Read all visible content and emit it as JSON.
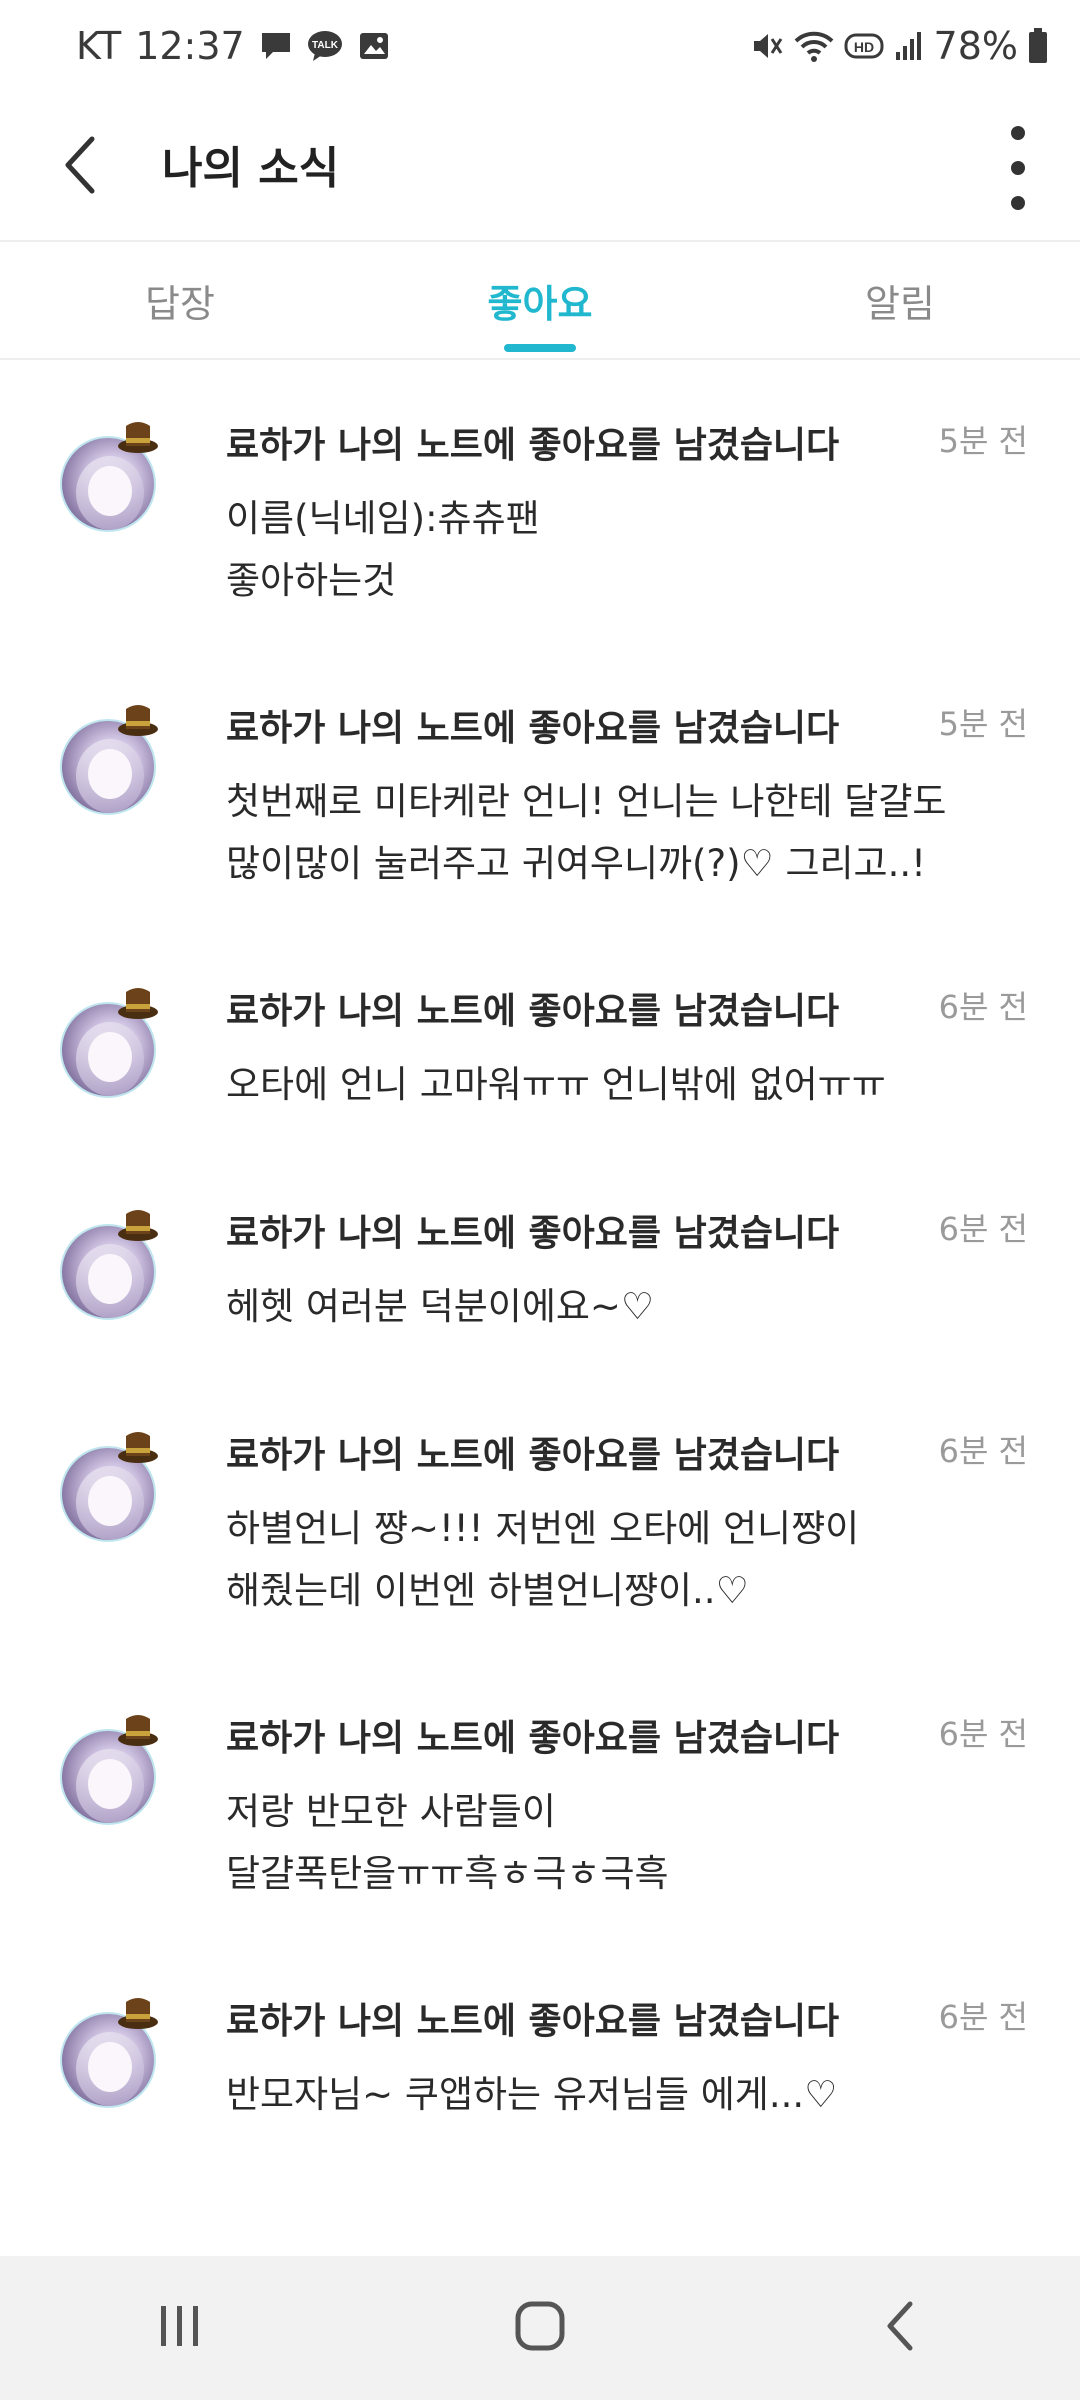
{
  "status_bar": {
    "carrier": "KT",
    "time": "12:37",
    "notif_icons": [
      "message-icon",
      "talk-icon",
      "image-icon"
    ],
    "talk_text": "TALK",
    "hd_text": "HD",
    "battery": "78%"
  },
  "header": {
    "title": "나의 소식"
  },
  "tabs": [
    {
      "label": "답장",
      "active": false
    },
    {
      "label": "좋아요",
      "active": true
    },
    {
      "label": "알림",
      "active": false
    }
  ],
  "colors": {
    "accent": "#20b7cf",
    "inactive_tab": "#8a8a8a",
    "time_text": "#9a9a9a"
  },
  "items": [
    {
      "title": "료하가 나의 노트에 좋아요를 남겼습니다",
      "time": "5분 전",
      "lines": [
        "이름(닉네임):츄츄팬",
        "좋아하는것"
      ]
    },
    {
      "title": "료하가 나의 노트에 좋아요를 남겼습니다",
      "time": "5분 전",
      "lines": [
        "첫번째로 미타케란 언니! 언니는 나한테 달걀도",
        "많이많이 눌러주고 귀여우니까(?)♡ 그리고..!"
      ]
    },
    {
      "title": "료하가 나의 노트에 좋아요를 남겼습니다",
      "time": "6분 전",
      "lines": [
        "오타에 언니 고마워ㅠㅠ 언니밖에 없어ㅠㅠ"
      ]
    },
    {
      "title": "료하가 나의 노트에 좋아요를 남겼습니다",
      "time": "6분 전",
      "lines": [
        "헤헷 여러분 덕분이에요~♡"
      ]
    },
    {
      "title": "료하가 나의 노트에 좋아요를 남겼습니다",
      "time": "6분 전",
      "lines": [
        "하별언니 쨩~!!! 저번엔 오타에 언니쨩이",
        "해줬는데 이번엔 하별언니쨩이..♡"
      ]
    },
    {
      "title": "료하가 나의 노트에 좋아요를 남겼습니다",
      "time": "6분 전",
      "lines": [
        "저랑 반모한 사람들이",
        "달걀폭탄을ㅠㅠ흑ㅎ극ㅎ극흑"
      ]
    },
    {
      "title": "료하가 나의 노트에 좋아요를 남겼습니다",
      "time": "6분 전",
      "lines": [
        "반모자님~ 쿠앱하는 유저님들 에게...♡"
      ]
    }
  ],
  "nav": [
    "recent-apps-icon",
    "home-icon",
    "back-icon"
  ]
}
